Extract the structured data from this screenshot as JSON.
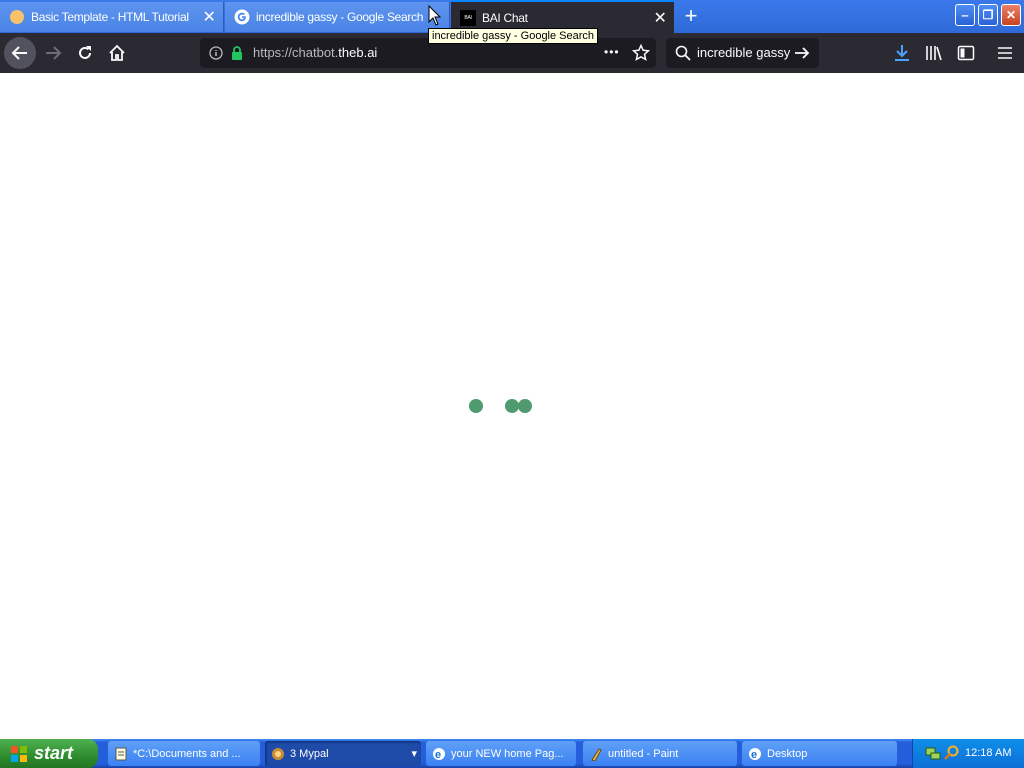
{
  "tabs": [
    {
      "title": "Basic Template - HTML Tutorial",
      "icon": "sun-favicon-icon",
      "close": "✕"
    },
    {
      "title": "incredible gassy - Google Search",
      "icon": "google-g-icon"
    },
    {
      "title": "BAI Chat",
      "icon": "bai-logo-icon",
      "favicon_text": "BAI",
      "close": "✕"
    }
  ],
  "new_tab": "+",
  "window_controls": {
    "minimize": "‒",
    "restore": "❐",
    "close": "✕"
  },
  "toolbar": {
    "url_prefix": "https://chatbot.",
    "url_domain": "theb.ai",
    "page_actions": "•••",
    "search_value": "incredible gassy"
  },
  "tooltip": "incredible gassy - Google Search",
  "page": {
    "loader": "loading-dots",
    "loader_color": "#4f9a6e"
  },
  "taskbar": {
    "start_label": "start",
    "buttons": [
      {
        "label": "*C:\\Documents and ...",
        "icon": "notepad-icon"
      },
      {
        "label": "3 Mypal",
        "icon": "mypal-icon",
        "dropdown": "▾"
      },
      {
        "label": "your NEW home Pag...",
        "icon": "ie-icon"
      },
      {
        "label": "untitled - Paint",
        "icon": "paint-icon"
      },
      {
        "label": "Desktop",
        "icon": "ie-icon"
      }
    ],
    "clock": "12:18 AM"
  },
  "colors": {
    "accent": "#0a84ff",
    "toolbar_bg": "#2b2a33",
    "taskbar": "#245edb",
    "start": "#2e8b2e"
  }
}
